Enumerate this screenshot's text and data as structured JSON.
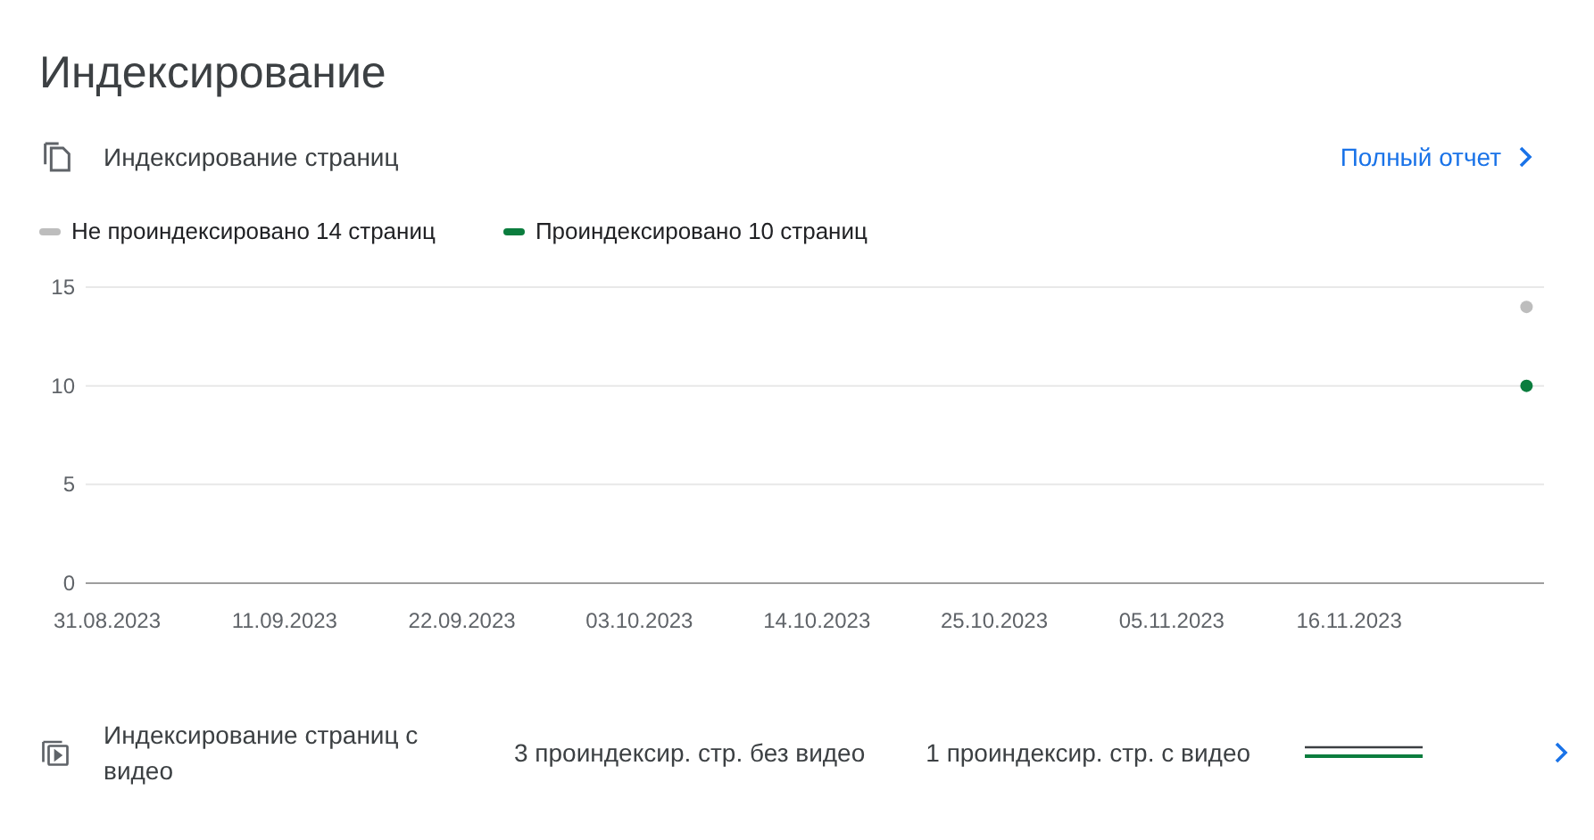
{
  "title": "Индексирование",
  "indexing": {
    "title": "Индексирование страниц",
    "link": "Полный отчет",
    "legend": [
      {
        "label": "Не проиндексировано 14 страниц",
        "color": "#bdbdbd"
      },
      {
        "label": "Проиндексировано 10 страниц",
        "color": "#0b7d3e"
      }
    ],
    "chart_data": {
      "type": "line",
      "categories": [
        "31.08.2023",
        "11.09.2023",
        "22.09.2023",
        "03.10.2023",
        "14.10.2023",
        "25.10.2023",
        "05.11.2023",
        "16.11.2023",
        null
      ],
      "ylim": [
        0,
        15
      ],
      "yticks": [
        0,
        5,
        10,
        15
      ],
      "series": [
        {
          "color": "#bdbdbd",
          "marker": "circle",
          "values": [
            null,
            null,
            null,
            null,
            null,
            null,
            null,
            null,
            14
          ]
        },
        {
          "color": "#0b7d3e",
          "marker": "circle",
          "values": [
            null,
            null,
            null,
            null,
            null,
            null,
            null,
            null,
            10
          ]
        }
      ]
    }
  },
  "video": {
    "title": "Индексирование страниц с видео",
    "stats": [
      "3 проиндексир. стр. без видео",
      "1 проиндексир. стр. с видео"
    ]
  }
}
